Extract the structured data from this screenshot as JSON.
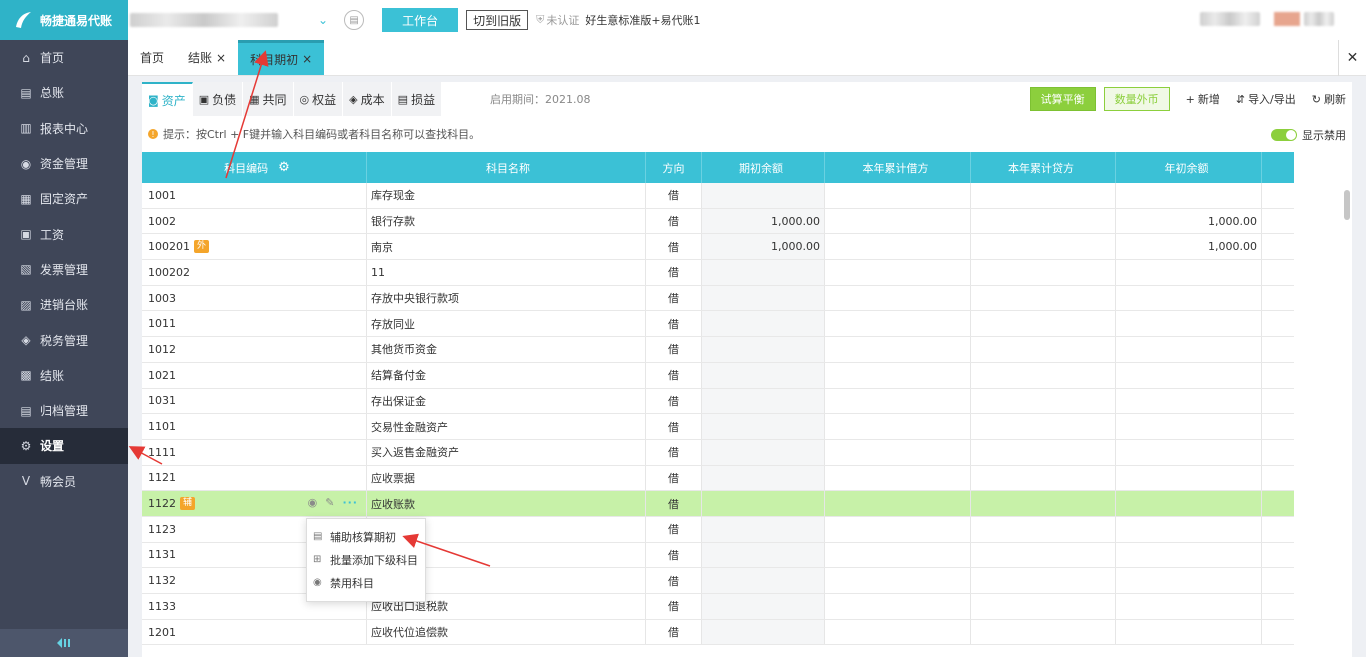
{
  "app": {
    "brand": "畅捷通易代账"
  },
  "topbar": {
    "workbench_label": "工作台",
    "switch_old_label": "切到旧版",
    "unverified_label": "未认证",
    "account_name": "好生意标准版+易代账1"
  },
  "sidebar": {
    "items": [
      {
        "label": "首页",
        "icon": "home-icon"
      },
      {
        "label": "总账",
        "icon": "ledger-icon"
      },
      {
        "label": "报表中心",
        "icon": "chart-icon"
      },
      {
        "label": "资金管理",
        "icon": "money-icon"
      },
      {
        "label": "固定资产",
        "icon": "asset-icon"
      },
      {
        "label": "工资",
        "icon": "salary-icon"
      },
      {
        "label": "发票管理",
        "icon": "invoice-icon"
      },
      {
        "label": "进销台账",
        "icon": "inventory-icon"
      },
      {
        "label": "税务管理",
        "icon": "tax-icon"
      },
      {
        "label": "结账",
        "icon": "close-books-icon"
      },
      {
        "label": "归档管理",
        "icon": "archive-icon"
      },
      {
        "label": "设置",
        "icon": "gear-icon"
      },
      {
        "label": "畅会员",
        "icon": "vip-icon"
      }
    ],
    "active_index": 11
  },
  "tabs": [
    {
      "label": "首页",
      "closable": false
    },
    {
      "label": "结账",
      "closable": true
    },
    {
      "label": "科目期初",
      "closable": true
    }
  ],
  "subtabs": [
    {
      "label": "资产",
      "icon": "asset-tab-icon"
    },
    {
      "label": "负债",
      "icon": "liability-icon"
    },
    {
      "label": "共同",
      "icon": "common-icon"
    },
    {
      "label": "权益",
      "icon": "equity-icon"
    },
    {
      "label": "成本",
      "icon": "cost-icon"
    },
    {
      "label": "损益",
      "icon": "profit-icon"
    }
  ],
  "enable_period": "启用期间：2021.08",
  "toolbar": {
    "trial_balance": "试算平衡",
    "qty_foreign": "数量外币",
    "add": "新增",
    "import_export": "导入/导出",
    "refresh": "刷新"
  },
  "hint": "提示：按Ctrl + F键并输入科目编码或者科目名称可以查找科目。",
  "toggle_label": "显示禁用",
  "table": {
    "columns": [
      "科目编码",
      "科目名称",
      "方向",
      "期初余额",
      "本年累计借方",
      "本年累计贷方",
      "年初余额"
    ],
    "rows": [
      {
        "code": "1001",
        "name": "库存现金",
        "dir": "借",
        "opening": "",
        "debit": "",
        "credit": "",
        "year_start": "",
        "badge": ""
      },
      {
        "code": "1002",
        "name": "银行存款",
        "dir": "借",
        "opening": "1,000.00",
        "debit": "",
        "credit": "",
        "year_start": "1,000.00",
        "badge": ""
      },
      {
        "code": "100201",
        "name": "南京",
        "dir": "借",
        "opening": "1,000.00",
        "debit": "",
        "credit": "",
        "year_start": "1,000.00",
        "badge": "外"
      },
      {
        "code": "100202",
        "name": "11",
        "dir": "借",
        "opening": "",
        "debit": "",
        "credit": "",
        "year_start": "",
        "badge": ""
      },
      {
        "code": "1003",
        "name": "存放中央银行款项",
        "dir": "借",
        "opening": "",
        "debit": "",
        "credit": "",
        "year_start": "",
        "badge": ""
      },
      {
        "code": "1011",
        "name": "存放同业",
        "dir": "借",
        "opening": "",
        "debit": "",
        "credit": "",
        "year_start": "",
        "badge": ""
      },
      {
        "code": "1012",
        "name": "其他货币资金",
        "dir": "借",
        "opening": "",
        "debit": "",
        "credit": "",
        "year_start": "",
        "badge": ""
      },
      {
        "code": "1021",
        "name": "结算备付金",
        "dir": "借",
        "opening": "",
        "debit": "",
        "credit": "",
        "year_start": "",
        "badge": ""
      },
      {
        "code": "1031",
        "name": "存出保证金",
        "dir": "借",
        "opening": "",
        "debit": "",
        "credit": "",
        "year_start": "",
        "badge": ""
      },
      {
        "code": "1101",
        "name": "交易性金融资产",
        "dir": "借",
        "opening": "",
        "debit": "",
        "credit": "",
        "year_start": "",
        "badge": ""
      },
      {
        "code": "1111",
        "name": "买入返售金融资产",
        "dir": "借",
        "opening": "",
        "debit": "",
        "credit": "",
        "year_start": "",
        "badge": ""
      },
      {
        "code": "1121",
        "name": "应收票据",
        "dir": "借",
        "opening": "",
        "debit": "",
        "credit": "",
        "year_start": "",
        "badge": ""
      },
      {
        "code": "1122",
        "name": "应收账款",
        "dir": "借",
        "opening": "",
        "debit": "",
        "credit": "",
        "year_start": "",
        "badge": "辅"
      },
      {
        "code": "1123",
        "name": "",
        "dir": "借",
        "opening": "",
        "debit": "",
        "credit": "",
        "year_start": "",
        "badge": ""
      },
      {
        "code": "1131",
        "name": "",
        "dir": "借",
        "opening": "",
        "debit": "",
        "credit": "",
        "year_start": "",
        "badge": ""
      },
      {
        "code": "1132",
        "name": "",
        "dir": "借",
        "opening": "",
        "debit": "",
        "credit": "",
        "year_start": "",
        "badge": ""
      },
      {
        "code": "1133",
        "name": "应收出口退税款",
        "dir": "借",
        "opening": "",
        "debit": "",
        "credit": "",
        "year_start": "",
        "badge": ""
      },
      {
        "code": "1201",
        "name": "应收代位追偿款",
        "dir": "借",
        "opening": "",
        "debit": "",
        "credit": "",
        "year_start": "",
        "badge": ""
      }
    ],
    "selected_index": 12
  },
  "context_menu": {
    "items": [
      {
        "label": "辅助核算期初",
        "icon": "doc-icon"
      },
      {
        "label": "批量添加下级科目",
        "icon": "add-sub-icon"
      },
      {
        "label": "禁用科目",
        "icon": "eye-icon"
      }
    ]
  },
  "colors": {
    "accent": "#3bc1d6",
    "sidebar": "#3f4658",
    "selected_row": "#c7f1a8",
    "green_button": "#8ccf3d",
    "annotation_arrow": "#e53935"
  }
}
